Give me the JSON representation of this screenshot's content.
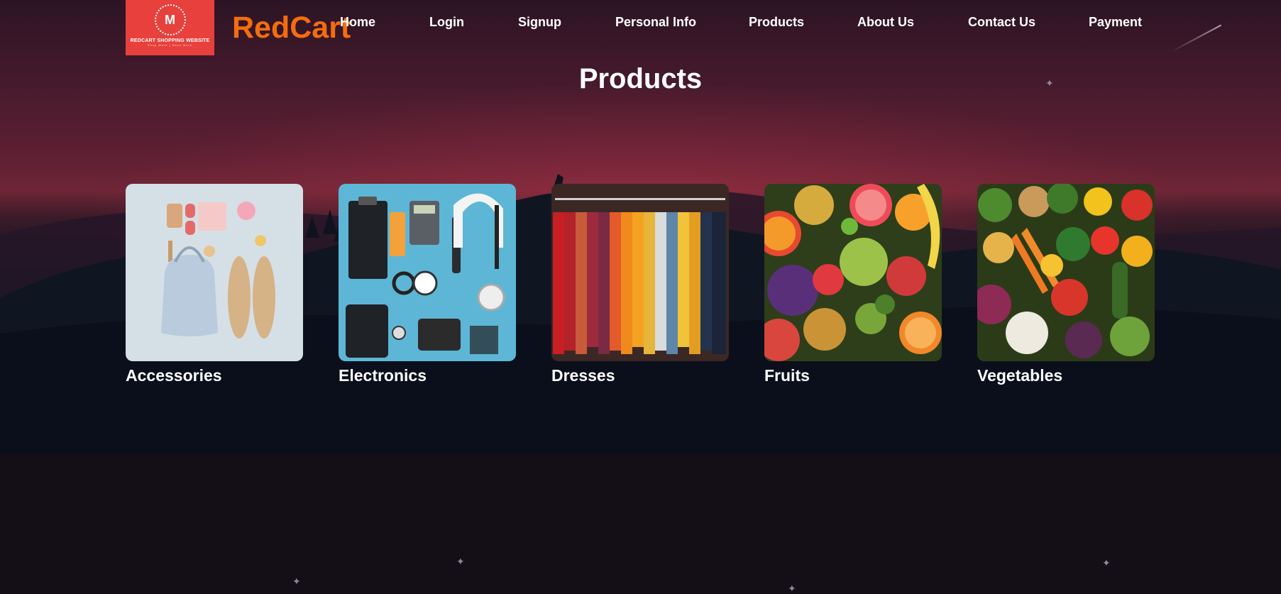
{
  "brand": {
    "logo_text": "REDCART SHOPPING WEBSITE",
    "logo_subtext": "Shop More | Save More",
    "logo_initial": "M",
    "name": "RedCart"
  },
  "nav": {
    "items": [
      {
        "label": "Home"
      },
      {
        "label": "Login"
      },
      {
        "label": "Signup"
      },
      {
        "label": "Personal Info"
      },
      {
        "label": "Products"
      },
      {
        "label": "About Us"
      },
      {
        "label": "Contact Us"
      },
      {
        "label": "Payment"
      }
    ]
  },
  "page": {
    "title": "Products"
  },
  "categories": [
    {
      "label": "Accessories"
    },
    {
      "label": "Electronics"
    },
    {
      "label": "Dresses"
    },
    {
      "label": "Fruits"
    },
    {
      "label": "Vegetables"
    }
  ],
  "colors": {
    "brand_orange": "#f36d0f",
    "logo_red": "#e8403c",
    "text_white": "#ffffff"
  }
}
